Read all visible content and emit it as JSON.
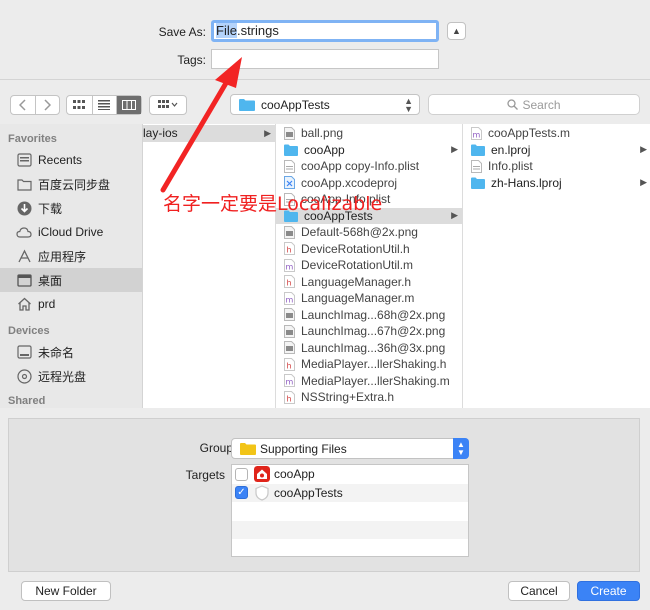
{
  "save_panel": {
    "save_as_label": "Save As:",
    "save_as_value_selected": "File",
    "save_as_value_rest": ".strings",
    "tags_label": "Tags:",
    "tags_value": ""
  },
  "toolbar": {
    "back_icon": "chevron-left-icon",
    "forward_icon": "chevron-right-icon",
    "view_modes": [
      "icon",
      "list",
      "column"
    ],
    "active_view": "column",
    "location": "cooAppTests",
    "search_placeholder": "Search"
  },
  "sidebar": {
    "favorites_header": "Favorites",
    "favorites": [
      {
        "label": "Recents",
        "icon": "recents-icon"
      },
      {
        "label": "百度云同步盘",
        "icon": "folder-icon"
      },
      {
        "label": "下载",
        "icon": "download-icon"
      },
      {
        "label": "iCloud Drive",
        "icon": "cloud-icon"
      },
      {
        "label": "应用程序",
        "icon": "applications-icon"
      },
      {
        "label": "桌面",
        "icon": "desktop-icon",
        "selected": true
      },
      {
        "label": "prd",
        "icon": "home-icon"
      }
    ],
    "devices_header": "Devices",
    "devices": [
      {
        "label": "未命名",
        "icon": "disk-icon"
      },
      {
        "label": "远程光盘",
        "icon": "optical-disc-icon"
      }
    ],
    "shared_header": "Shared"
  },
  "columns": {
    "col1": [
      {
        "label": "lay-ios",
        "dir": true,
        "selected": true
      }
    ],
    "col2": [
      {
        "label": "ball.png",
        "type": "image"
      },
      {
        "label": "cooApp",
        "type": "folder",
        "dir": true
      },
      {
        "label": "cooApp copy-Info.plist",
        "type": "plist"
      },
      {
        "label": "cooApp.xcodeproj",
        "type": "xcodeproj"
      },
      {
        "label": "cooApp-Info.plist",
        "type": "plist"
      },
      {
        "label": "cooAppTests",
        "type": "folder",
        "dir": true,
        "selected": true
      },
      {
        "label": "Default-568h@2x.png",
        "type": "image"
      },
      {
        "label": "DeviceRotationUtil.h",
        "type": "h"
      },
      {
        "label": "DeviceRotationUtil.m",
        "type": "m"
      },
      {
        "label": "LanguageManager.h",
        "type": "h"
      },
      {
        "label": "LanguageManager.m",
        "type": "m"
      },
      {
        "label": "LaunchImag...68h@2x.png",
        "type": "image"
      },
      {
        "label": "LaunchImag...67h@2x.png",
        "type": "image"
      },
      {
        "label": "LaunchImag...36h@3x.png",
        "type": "image"
      },
      {
        "label": "MediaPlayer...llerShaking.h",
        "type": "h"
      },
      {
        "label": "MediaPlayer...llerShaking.m",
        "type": "m"
      },
      {
        "label": "NSString+Extra.h",
        "type": "h"
      }
    ],
    "col3": [
      {
        "label": "cooAppTests.m",
        "type": "m"
      },
      {
        "label": "en.lproj",
        "type": "folder",
        "dir": true
      },
      {
        "label": "Info.plist",
        "type": "plist"
      },
      {
        "label": "zh-Hans.lproj",
        "type": "folder",
        "dir": true
      }
    ]
  },
  "options": {
    "group_label": "Group",
    "group_value": "Supporting Files",
    "targets_label": "Targets",
    "targets": [
      {
        "label": "cooApp",
        "checked": false,
        "icon": "app-target-icon"
      },
      {
        "label": "cooAppTests",
        "checked": true,
        "icon": "test-target-icon"
      }
    ]
  },
  "footer": {
    "new_folder_label": "New Folder",
    "cancel_label": "Cancel",
    "create_label": "Create"
  },
  "annotation": {
    "text": "名字一定要是Localizable",
    "color": "#f02020"
  },
  "colors": {
    "accent": "#3b83f6",
    "folder_blue": "#4fb6ee",
    "selection": "#dcdcdc"
  }
}
